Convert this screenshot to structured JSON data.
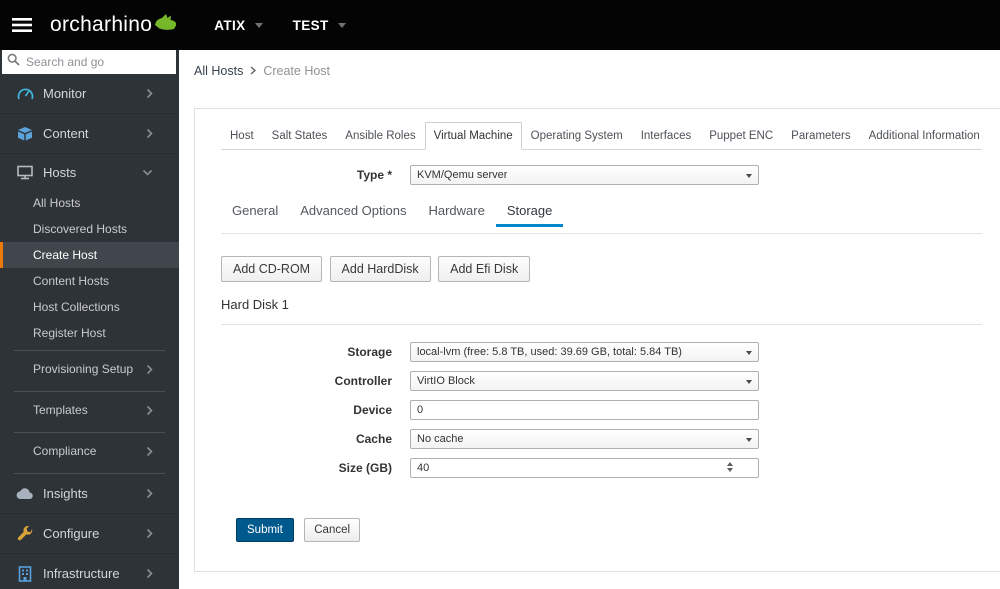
{
  "topbar": {
    "brand": "orcharhino",
    "menus": [
      {
        "label": "ATIX"
      },
      {
        "label": "TEST"
      }
    ]
  },
  "sidebar": {
    "search": {
      "placeholder": "Search and go"
    },
    "items": [
      {
        "label": "Monitor",
        "icon": "gauge-icon"
      },
      {
        "label": "Content",
        "icon": "package-icon"
      },
      {
        "label": "Hosts",
        "icon": "server-icon",
        "expanded": true
      },
      {
        "label": "Insights",
        "icon": "cloud-icon"
      },
      {
        "label": "Configure",
        "icon": "wrench-icon"
      },
      {
        "label": "Infrastructure",
        "icon": "building-icon"
      }
    ],
    "hosts_submenu": [
      {
        "label": "All Hosts"
      },
      {
        "label": "Discovered Hosts"
      },
      {
        "label": "Create Host",
        "active": true
      },
      {
        "label": "Content Hosts"
      },
      {
        "label": "Host Collections"
      },
      {
        "label": "Register Host"
      },
      {
        "label": "Provisioning Setup",
        "has_children": true
      },
      {
        "label": "Templates",
        "has_children": true
      },
      {
        "label": "Compliance",
        "has_children": true
      }
    ]
  },
  "breadcrumb": {
    "items": [
      {
        "label": "All Hosts"
      },
      {
        "label": "Create Host"
      }
    ]
  },
  "tabs": {
    "items": [
      {
        "label": "Host"
      },
      {
        "label": "Salt States"
      },
      {
        "label": "Ansible Roles"
      },
      {
        "label": "Virtual Machine",
        "active": true
      },
      {
        "label": "Operating System"
      },
      {
        "label": "Interfaces"
      },
      {
        "label": "Puppet ENC"
      },
      {
        "label": "Parameters"
      },
      {
        "label": "Additional Information"
      }
    ]
  },
  "form": {
    "type": {
      "label": "Type *",
      "value": "KVM/Qemu server"
    },
    "subtabs": [
      {
        "label": "General"
      },
      {
        "label": "Advanced Options"
      },
      {
        "label": "Hardware"
      },
      {
        "label": "Storage",
        "active": true
      }
    ],
    "add_buttons": [
      {
        "label": "Add CD-ROM"
      },
      {
        "label": "Add HardDisk"
      },
      {
        "label": "Add Efi Disk"
      }
    ],
    "disk_title": "Hard Disk 1",
    "fields": [
      {
        "label": "Storage",
        "value": "local-lvm (free: 5.8 TB, used: 39.69 GB, total: 5.84 TB)",
        "control": "select"
      },
      {
        "label": "Controller",
        "value": "VirtIO Block",
        "control": "select"
      },
      {
        "label": "Device",
        "value": "0",
        "control": "number"
      },
      {
        "label": "Cache",
        "value": "No cache",
        "control": "select"
      },
      {
        "label": "Size (GB)",
        "value": "40",
        "control": "number"
      }
    ],
    "actions": {
      "submit": "Submit",
      "cancel": "Cancel"
    }
  },
  "colors": {
    "topbar_bg": "#040404",
    "sidebar_bg": "#2e3338",
    "active_item_accent": "#ec7a08",
    "subtab_accent": "#0088ce",
    "primary_button": "#00598c",
    "brand_green": "#76b82a"
  }
}
